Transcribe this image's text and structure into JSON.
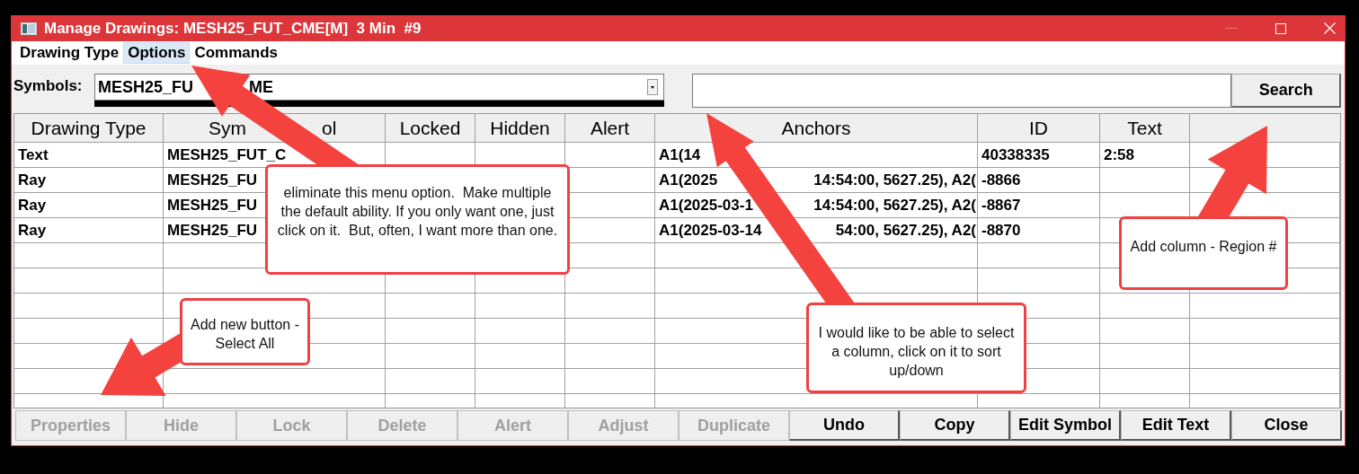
{
  "window": {
    "title": "Manage Drawings: MESH25_FUT_CME[M]  3 Min  #9"
  },
  "menu": [
    {
      "label": "Drawing Type",
      "selected": false
    },
    {
      "label": "Options",
      "selected": true
    },
    {
      "label": "Commands",
      "selected": false
    }
  ],
  "symbols": {
    "label": "Symbols:",
    "value_parts": [
      "MESH25_FU",
      "ME"
    ]
  },
  "search": {
    "button": "Search"
  },
  "table": {
    "columns": [
      {
        "label": "Drawing Type"
      },
      {
        "parts": [
          "Sym",
          "ol"
        ]
      },
      {
        "label": "Locked"
      },
      {
        "label": "Hidden"
      },
      {
        "label": "Alert"
      },
      {
        "label": "Anchors"
      },
      {
        "label": "ID"
      },
      {
        "label": "Text"
      }
    ],
    "rows": [
      {
        "type": "Text",
        "symbol": "MESH25_FUT_C",
        "anchors": [
          "A1(14"
        ],
        "id": "40338335",
        "text": "2:58"
      },
      {
        "type": "Ray",
        "symbol": "MESH25_FU",
        "anchors": [
          "A1(2025",
          "14:54:00, 5627.25), A2("
        ],
        "id": "-8866"
      },
      {
        "type": "Ray",
        "symbol": "MESH25_FU",
        "anchors": [
          "A1(2025-03-1",
          "14:54:00, 5627.25), A2("
        ],
        "id": "-8867"
      },
      {
        "type": "Ray",
        "symbol": "MESH25_FU",
        "anchors": [
          "A1(2025-03-14",
          "54:00, 5627.25), A2("
        ],
        "id": "-8870"
      }
    ]
  },
  "buttons": [
    {
      "label": "Properties",
      "disabled": true
    },
    {
      "label": "Hide",
      "disabled": true
    },
    {
      "label": "Lock",
      "disabled": true
    },
    {
      "label": "Delete",
      "disabled": true
    },
    {
      "label": "Alert",
      "disabled": true
    },
    {
      "label": "Adjust",
      "disabled": true
    },
    {
      "label": "Duplicate",
      "disabled": true
    },
    {
      "label": "Undo",
      "disabled": false
    },
    {
      "label": "Copy",
      "disabled": false
    },
    {
      "label": "Edit Symbol",
      "disabled": false
    },
    {
      "label": "Edit Text",
      "disabled": false
    },
    {
      "label": "Close",
      "disabled": false
    }
  ],
  "annotations": [
    {
      "text": "eliminate this menu option.  Make multiple the default ability. If you only want one, just click on it.  But, often, I want more than one."
    },
    {
      "text": "Add new button - Select All"
    },
    {
      "text": "I would like to be able to select a column, click on it to sort up/down"
    },
    {
      "text": "Add column - Region #"
    }
  ]
}
